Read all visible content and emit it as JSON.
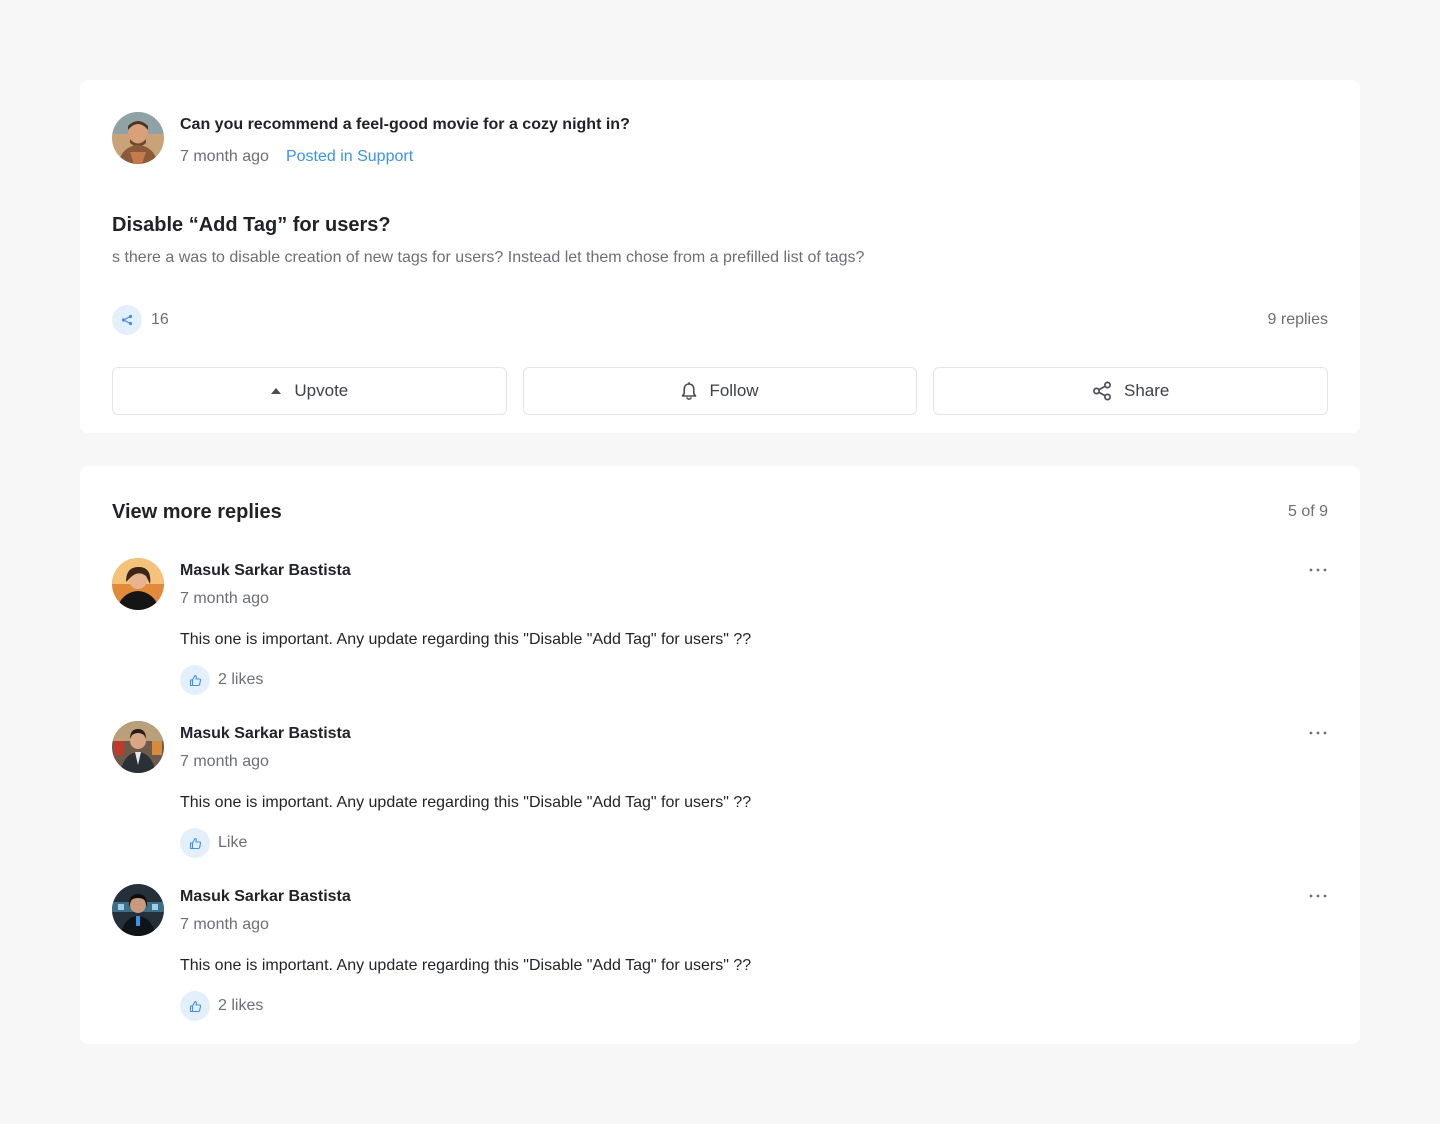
{
  "post": {
    "question": "Can you recommend a feel-good movie for a cozy night in?",
    "time": "7 month ago",
    "posted_in": "Posted in Support",
    "title": "Disable “Add Tag” for users?",
    "body": "s there a was to disable creation of new tags for users? Instead let them chose from a prefilled list of tags?",
    "share_count": "16",
    "replies_count": "9 replies",
    "actions": {
      "upvote": "Upvote",
      "follow": "Follow",
      "share": "Share"
    }
  },
  "replies": {
    "title": "View more replies",
    "pager": "5 of 9",
    "items": [
      {
        "name": "Masuk Sarkar Bastista",
        "time": "7 month ago",
        "text": "This one is important. Any update regarding this \"Disable \"Add Tag\" for users\" ??",
        "likes": "2 likes"
      },
      {
        "name": "Masuk Sarkar Bastista",
        "time": "7 month ago",
        "text": "This one is important. Any update regarding this \"Disable \"Add Tag\" for users\" ??",
        "likes": "Like"
      },
      {
        "name": "Masuk Sarkar Bastista",
        "time": "7 month ago",
        "text": "This one is important. Any update regarding this \"Disable \"Add Tag\" for users\" ??",
        "likes": "2 likes"
      }
    ]
  },
  "colors": {
    "accent": "#3b93e8",
    "icon_bg": "#e3f0fc",
    "muted_text": "#6b6f76",
    "page_bg": "#f7f7f8"
  }
}
